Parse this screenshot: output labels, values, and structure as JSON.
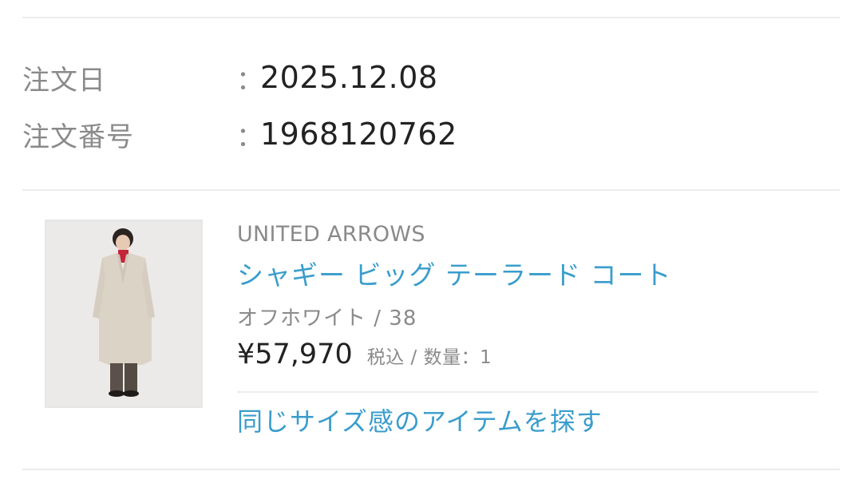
{
  "order": {
    "date_label": "注文日",
    "date_value": "2025.12.08",
    "number_label": "注文番号",
    "number_value": "1968120762",
    "colon": "："
  },
  "item": {
    "brand": "UNITED ARROWS",
    "name": "シャギー ビッグ テーラード コート",
    "variant": "オフホワイト / 38",
    "price": "¥57,970",
    "tax_qty": "税込 / 数量：1",
    "similar_link": "同じサイズ感のアイテムを探す",
    "image_icon": "coat-product-photo"
  },
  "colors": {
    "link": "#3a9dcc",
    "label": "#8a8a8a",
    "text": "#222222",
    "divider": "#ececec"
  }
}
